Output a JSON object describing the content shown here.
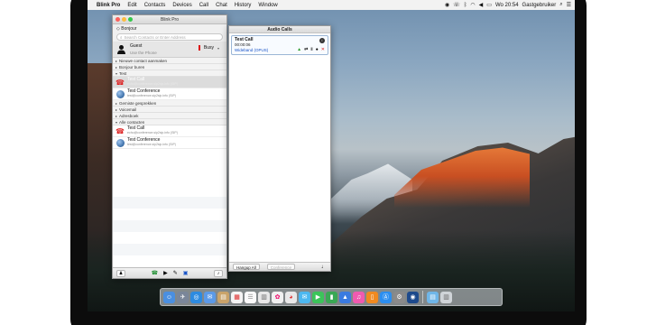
{
  "menubar": {
    "app_name": "Blink Pro",
    "items": [
      "Edit",
      "Contacts",
      "Devices",
      "Call",
      "Chat",
      "History",
      "Window"
    ],
    "clock": "Wo 20:54",
    "user": "Gastgebruiker"
  },
  "main_window": {
    "title": "Blink Pro",
    "account": "Bonjour",
    "search_placeholder": "Search Contacts or Enter Address",
    "guest": {
      "name": "Guest",
      "status_text": "Use the Phone",
      "presence": "Busy",
      "presence_color": "#d11111"
    },
    "sections": [
      {
        "type": "group",
        "label": "Nieuwe contact aanmaken"
      },
      {
        "type": "group",
        "label": "Bonjour buren"
      },
      {
        "type": "group",
        "label": "Test"
      },
      {
        "type": "contact",
        "name": "Test Call",
        "sub": "echo@conference.sip2sip.info (SIP)",
        "icon": "phone",
        "selected": true
      },
      {
        "type": "contact",
        "name": "Test Conference",
        "sub": "test@conference.sip2sip.info (SIP)",
        "icon": "globe",
        "selected": false
      },
      {
        "type": "group",
        "label": "Gemiste gesprekken"
      },
      {
        "type": "group",
        "label": "Voicemail"
      },
      {
        "type": "group",
        "label": "Adresboek"
      },
      {
        "type": "group",
        "label": "Alle contacten"
      },
      {
        "type": "contact",
        "name": "Test Call",
        "sub": "echo@conference.sip2sip.info (SIP)",
        "icon": "phone",
        "selected": false
      },
      {
        "type": "contact",
        "name": "Test Conference",
        "sub": "test@conference.sip2sip.info (SIP)",
        "icon": "globe",
        "selected": false
      }
    ]
  },
  "audio_window": {
    "title": "Audio Calls",
    "call": {
      "name": "Test Call",
      "duration": "00:00:06",
      "codec": "Wideband (OPUS)"
    },
    "hangup_all": "Hangup All",
    "conference": "Conference"
  }
}
